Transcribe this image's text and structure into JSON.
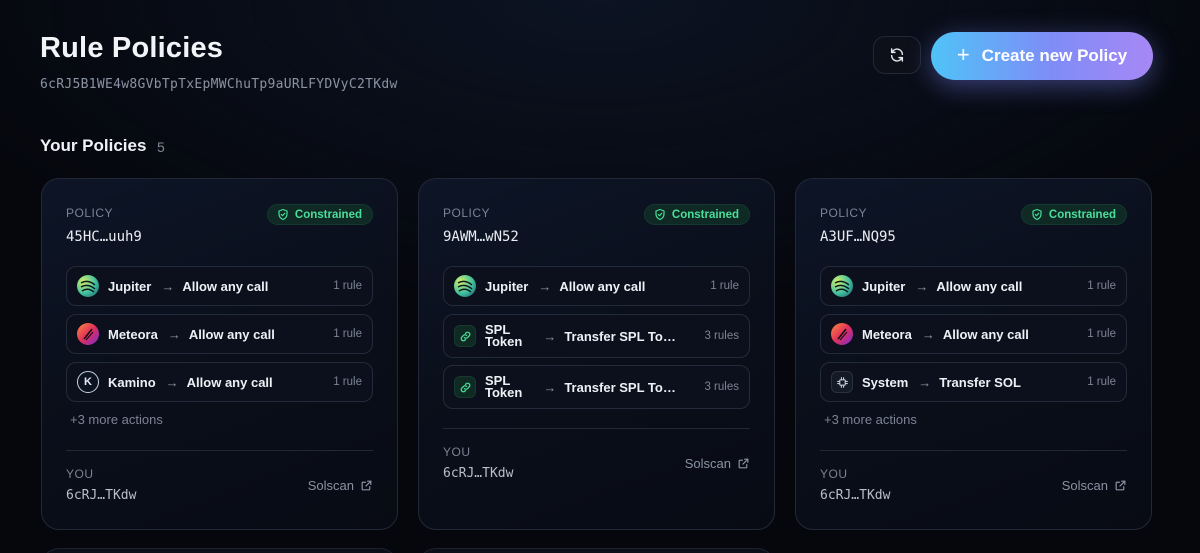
{
  "header": {
    "title": "Rule Policies",
    "address": "6cRJ5B1WE4w8GVbTpTxEpMWChuTp9aURLFYDVyC2TKdw",
    "refresh_icon": "refresh-icon",
    "create_label": "Create new Policy",
    "create_icon": "plus-icon"
  },
  "section": {
    "title": "Your Policies",
    "count": "5"
  },
  "colors": {
    "accent_start": "#4fc3f7",
    "accent_end": "#a688f5",
    "constrained": "#4ade9b"
  },
  "cards": [
    {
      "policy_label": "POLICY",
      "policy_id": "45HC…uuh9",
      "badge": "Constrained",
      "rows": [
        {
          "program": "Jupiter",
          "action": "Allow any call",
          "rules": "1 rule",
          "icon": "jupiter-icon"
        },
        {
          "program": "Meteora",
          "action": "Allow any call",
          "rules": "1 rule",
          "icon": "meteora-icon"
        },
        {
          "program": "Kamino",
          "action": "Allow any call",
          "rules": "1 rule",
          "icon": "kamino-icon"
        }
      ],
      "more": "+3 more actions",
      "you_label": "YOU",
      "you_id": "6cRJ…TKdw",
      "solscan": "Solscan"
    },
    {
      "policy_label": "POLICY",
      "policy_id": "9AWM…wN52",
      "badge": "Constrained",
      "rows": [
        {
          "program": "Jupiter",
          "action": "Allow any call",
          "rules": "1 rule",
          "icon": "jupiter-icon"
        },
        {
          "program_line1": "SPL",
          "program_line2": "Token",
          "action": "Transfer SPL Tok…",
          "rules": "3 rules",
          "icon": "link-icon"
        },
        {
          "program_line1": "SPL",
          "program_line2": "Token",
          "action": "Transfer SPL Tok…",
          "rules": "3 rules",
          "icon": "link-icon"
        }
      ],
      "you_label": "YOU",
      "you_id": "6cRJ…TKdw",
      "solscan": "Solscan"
    },
    {
      "policy_label": "POLICY",
      "policy_id": "A3UF…NQ95",
      "badge": "Constrained",
      "rows": [
        {
          "program": "Jupiter",
          "action": "Allow any call",
          "rules": "1 rule",
          "icon": "jupiter-icon"
        },
        {
          "program": "Meteora",
          "action": "Allow any call",
          "rules": "1 rule",
          "icon": "meteora-icon"
        },
        {
          "program": "System",
          "action": "Transfer SOL",
          "rules": "1 rule",
          "icon": "chip-icon"
        }
      ],
      "more": "+3 more actions",
      "you_label": "YOU",
      "you_id": "6cRJ…TKdw",
      "solscan": "Solscan"
    }
  ]
}
